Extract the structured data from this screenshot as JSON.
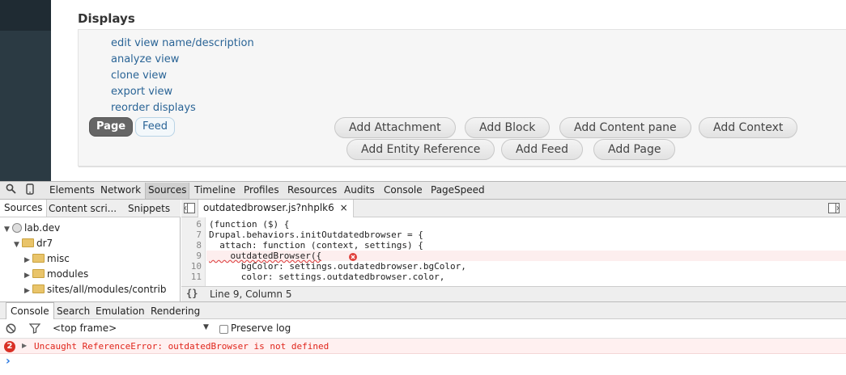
{
  "displays": {
    "title": "Displays",
    "actions": [
      "edit view name/description",
      "analyze view",
      "clone view",
      "export view",
      "reorder displays"
    ],
    "tabs": [
      "Page",
      "Feed"
    ],
    "add_buttons_row1": [
      "Add Attachment",
      "Add Block",
      "Add Content pane",
      "Add Context"
    ],
    "add_buttons_row2": [
      "Add Entity Reference",
      "Add Feed",
      "Add Page"
    ]
  },
  "devtools": {
    "tabs": [
      "Elements",
      "Network",
      "Sources",
      "Timeline",
      "Profiles",
      "Resources",
      "Audits",
      "Console",
      "PageSpeed"
    ],
    "sources_subtabs": [
      "Sources",
      "Content scri...",
      "Snippets"
    ],
    "tree": [
      "lab.dev",
      "dr7",
      "misc",
      "modules",
      "sites/all/modules/contrib"
    ],
    "file_tab": "outdatedbrowser.js?nhplk6",
    "close_glyph": "×",
    "code_lines": [
      {
        "n": "6",
        "text": "(function ($) {"
      },
      {
        "n": "7",
        "text": "Drupal.behaviors.initOutdatedbrowser = {"
      },
      {
        "n": "8",
        "text": "  attach: function (context, settings) {"
      },
      {
        "n": "9",
        "text": "    outdatedBrowser({"
      },
      {
        "n": "10",
        "text": "      bgColor: settings.outdatedbrowser.bgColor,"
      },
      {
        "n": "11",
        "text": "      color: settings.outdatedbrowser.color,"
      }
    ],
    "braces": "{}",
    "cursor_status": "Line 9, Column 5",
    "console_tabs": [
      "Console",
      "Search",
      "Emulation",
      "Rendering"
    ],
    "frame_select": "<top frame>",
    "preserve_log": "Preserve log",
    "error_count": "2",
    "error_message": "Uncaught ReferenceError: outdatedBrowser is not defined",
    "prompt": "›"
  }
}
